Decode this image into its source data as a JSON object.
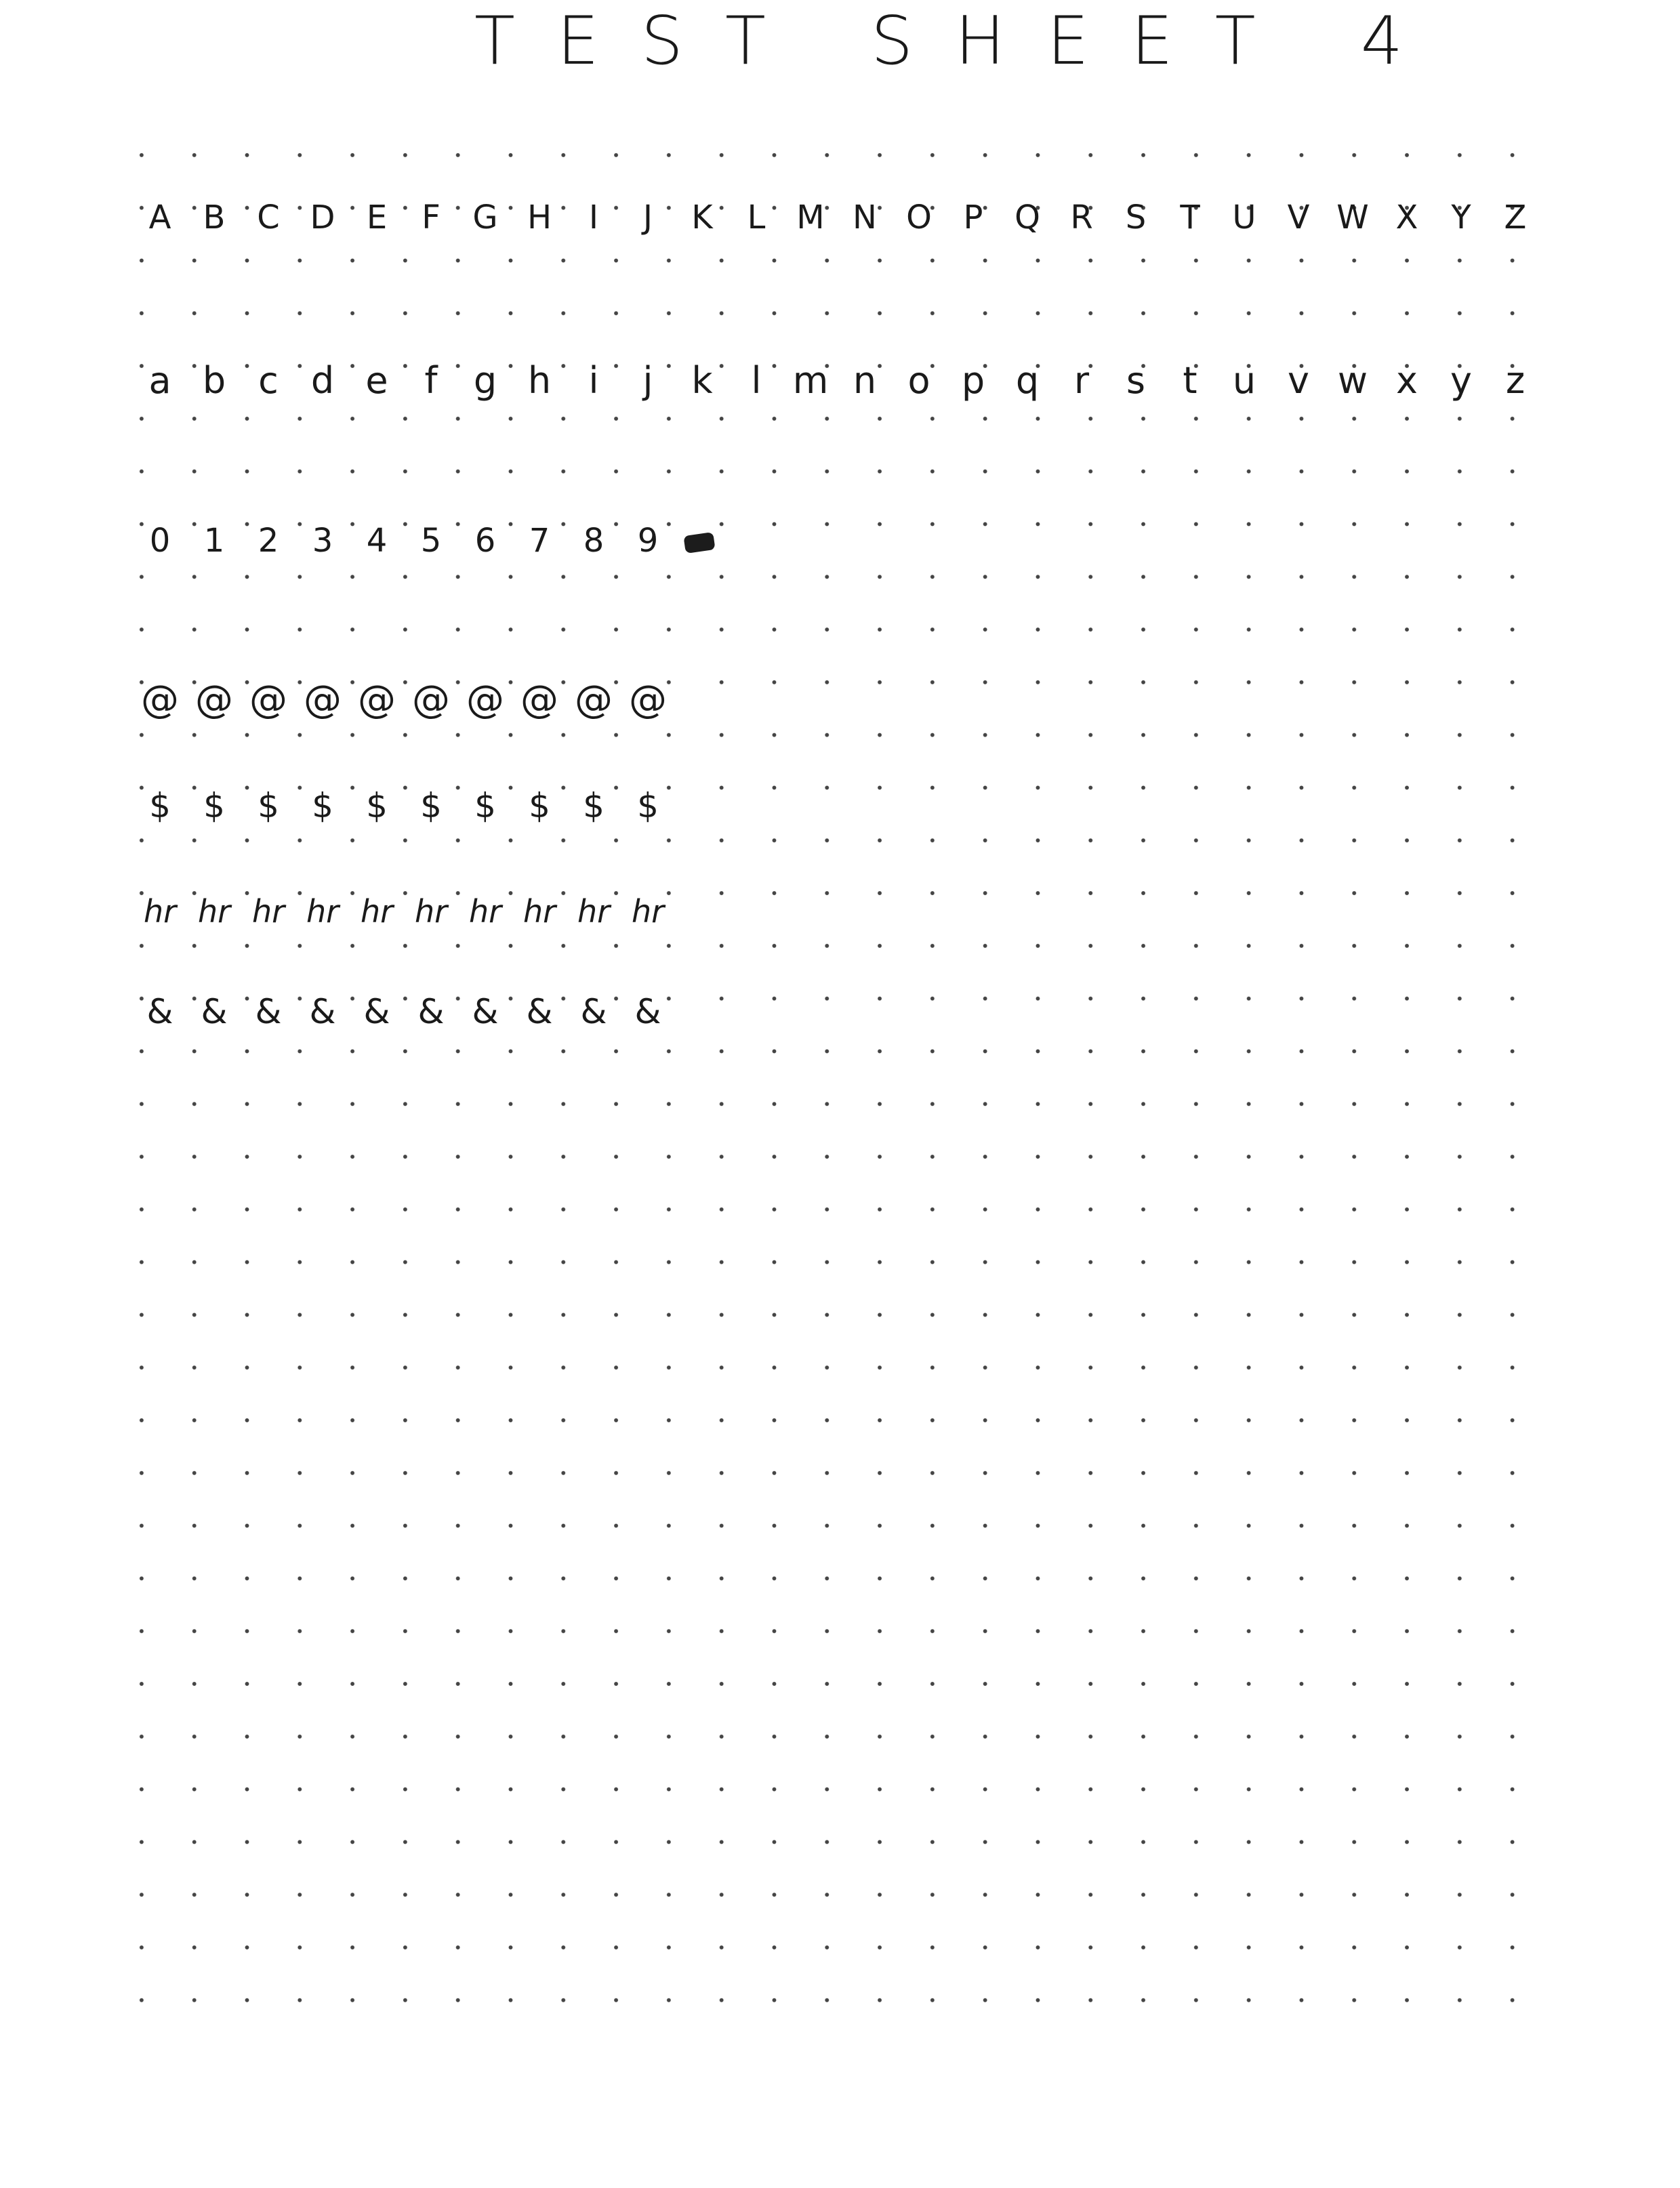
{
  "title": "TEST SHEET 4",
  "rows": {
    "uppercase": [
      "A",
      "B",
      "C",
      "D",
      "E",
      "F",
      "G",
      "H",
      "I",
      "J",
      "K",
      "L",
      "M",
      "N",
      "O",
      "P",
      "Q",
      "R",
      "S",
      "T",
      "U",
      "V",
      "W",
      "X",
      "Y",
      "Z"
    ],
    "lowercase": [
      "a",
      "b",
      "c",
      "d",
      "e",
      "f",
      "g",
      "h",
      "i",
      "j",
      "k",
      "l",
      "m",
      "n",
      "o",
      "p",
      "q",
      "r",
      "s",
      "t",
      "u",
      "v",
      "w",
      "x",
      "y",
      "z"
    ],
    "digits": [
      "0",
      "1",
      "2",
      "3",
      "4",
      "5",
      "6",
      "7",
      "8",
      "9"
    ],
    "at_signs": [
      "@",
      "@",
      "@",
      "@",
      "@",
      "@",
      "@",
      "@",
      "@",
      "@"
    ],
    "dollar_signs": [
      "$",
      "$",
      "$",
      "$",
      "$",
      "$",
      "$",
      "$",
      "$",
      "$"
    ],
    "hr_pairs": [
      "hr",
      "hr",
      "hr",
      "hr",
      "hr",
      "hr",
      "hr",
      "hr",
      "hr",
      "hr"
    ],
    "ampersands": [
      "&",
      "&",
      "&",
      "&",
      "&",
      "&",
      "&",
      "&",
      "&",
      "&"
    ]
  },
  "ink_color": "#1a1a1a",
  "paper_color": "#ffffff"
}
